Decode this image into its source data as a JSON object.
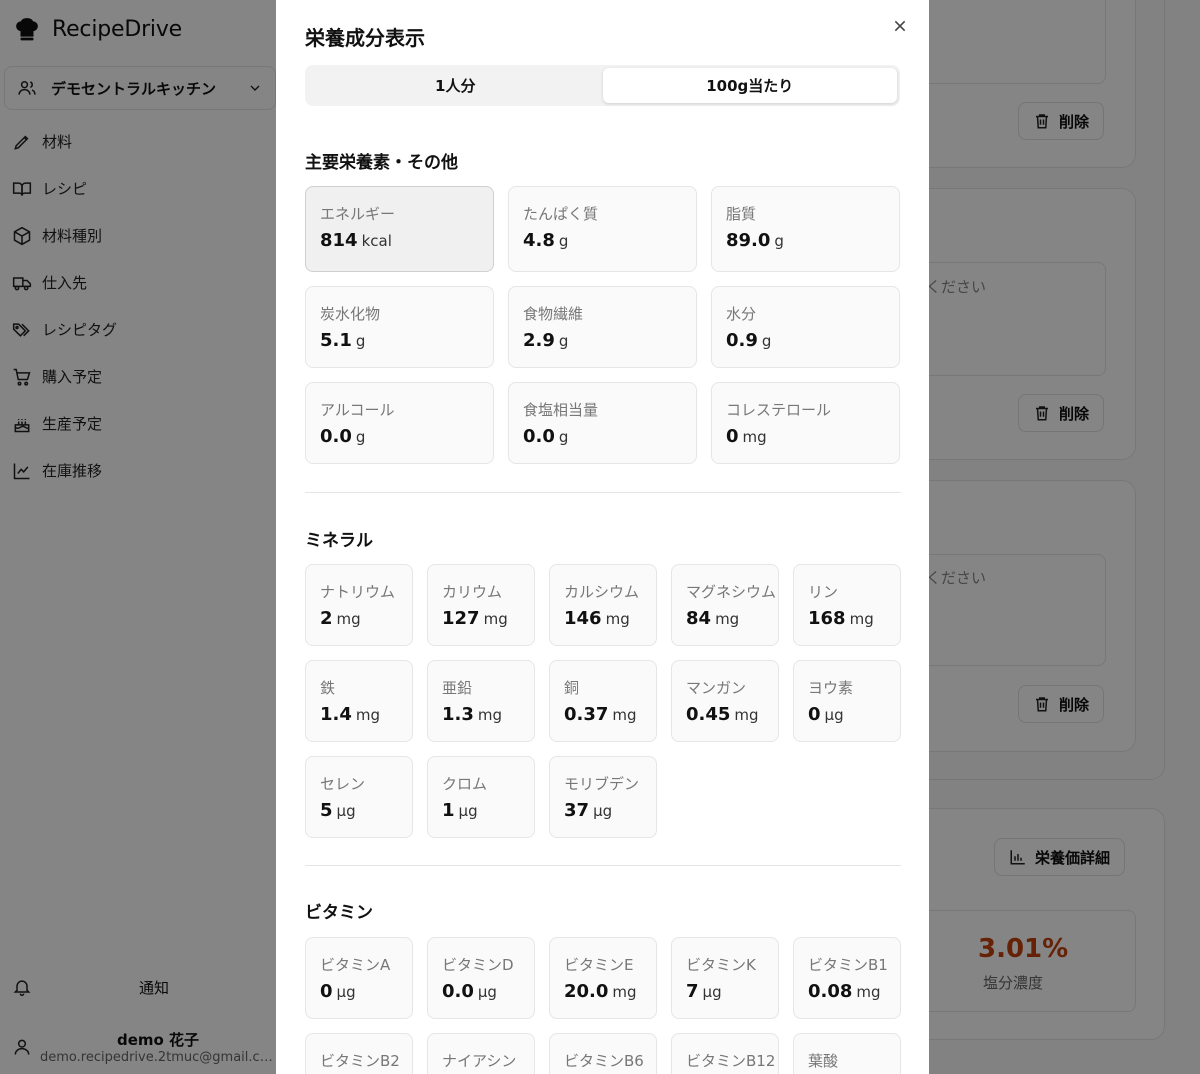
{
  "app": {
    "brand": "RecipeDrive",
    "kitchen": "デモセントラルキッチン",
    "nav": [
      {
        "label": "材料",
        "icon": "pencil-icon"
      },
      {
        "label": "レシピ",
        "icon": "book-icon"
      },
      {
        "label": "材料種別",
        "icon": "cube-icon"
      },
      {
        "label": "仕入先",
        "icon": "truck-icon"
      },
      {
        "label": "レシピタグ",
        "icon": "tags-icon"
      },
      {
        "label": "購入予定",
        "icon": "cart-icon"
      },
      {
        "label": "生産予定",
        "icon": "cake-icon"
      },
      {
        "label": "在庫推移",
        "icon": "chart-line-icon"
      }
    ],
    "notifications": "通知",
    "user_name": "demo 花子",
    "user_email": "demo.recipedrive.2tmuc@gmail.co...",
    "bg_delete": "削除",
    "bg_placeholder_fragment": "ください",
    "bg_nutrition_detail": "栄養価詳細",
    "bg_salt_value": "3.01%",
    "bg_salt_label": "塩分濃度"
  },
  "modal": {
    "title": "栄養成分表示",
    "tabs": [
      "1人分",
      "100g当たり"
    ],
    "active_tab": 1,
    "sections": {
      "main": {
        "title": "主要栄養素・その他",
        "items": [
          {
            "name": "エネルギー",
            "value": "814",
            "unit": "kcal"
          },
          {
            "name": "たんぱく質",
            "value": "4.8",
            "unit": "g"
          },
          {
            "name": "脂質",
            "value": "89.0",
            "unit": "g"
          },
          {
            "name": "炭水化物",
            "value": "5.1",
            "unit": "g"
          },
          {
            "name": "食物繊維",
            "value": "2.9",
            "unit": "g"
          },
          {
            "name": "水分",
            "value": "0.9",
            "unit": "g"
          },
          {
            "name": "アルコール",
            "value": "0.0",
            "unit": "g"
          },
          {
            "name": "食塩相当量",
            "value": "0.0",
            "unit": "g"
          },
          {
            "name": "コレステロール",
            "value": "0",
            "unit": "mg"
          }
        ]
      },
      "mineral": {
        "title": "ミネラル",
        "items": [
          {
            "name": "ナトリウム",
            "value": "2",
            "unit": "mg"
          },
          {
            "name": "カリウム",
            "value": "127",
            "unit": "mg"
          },
          {
            "name": "カルシウム",
            "value": "146",
            "unit": "mg"
          },
          {
            "name": "マグネシウム",
            "value": "84",
            "unit": "mg"
          },
          {
            "name": "リン",
            "value": "168",
            "unit": "mg"
          },
          {
            "name": "鉄",
            "value": "1.4",
            "unit": "mg"
          },
          {
            "name": "亜鉛",
            "value": "1.3",
            "unit": "mg"
          },
          {
            "name": "銅",
            "value": "0.37",
            "unit": "mg"
          },
          {
            "name": "マンガン",
            "value": "0.45",
            "unit": "mg"
          },
          {
            "name": "ヨウ素",
            "value": "0",
            "unit": "µg"
          },
          {
            "name": "セレン",
            "value": "5",
            "unit": "µg"
          },
          {
            "name": "クロム",
            "value": "1",
            "unit": "µg"
          },
          {
            "name": "モリブデン",
            "value": "37",
            "unit": "µg"
          }
        ]
      },
      "vitamin": {
        "title": "ビタミン",
        "items": [
          {
            "name": "ビタミンA",
            "value": "0",
            "unit": "µg"
          },
          {
            "name": "ビタミンD",
            "value": "0.0",
            "unit": "µg"
          },
          {
            "name": "ビタミンE",
            "value": "20.0",
            "unit": "mg"
          },
          {
            "name": "ビタミンK",
            "value": "7",
            "unit": "µg"
          },
          {
            "name": "ビタミンB1",
            "value": "0.08",
            "unit": "mg"
          },
          {
            "name": "ビタミンB2",
            "value": "",
            "unit": ""
          },
          {
            "name": "ナイアシン",
            "value": "",
            "unit": ""
          },
          {
            "name": "ビタミンB6",
            "value": "",
            "unit": ""
          },
          {
            "name": "ビタミンB12",
            "value": "",
            "unit": ""
          },
          {
            "name": "葉酸",
            "value": "",
            "unit": ""
          }
        ]
      }
    }
  },
  "colors": {
    "accent_salt": "#c2410c",
    "overlay": "rgba(0,0,0,0.48)"
  }
}
